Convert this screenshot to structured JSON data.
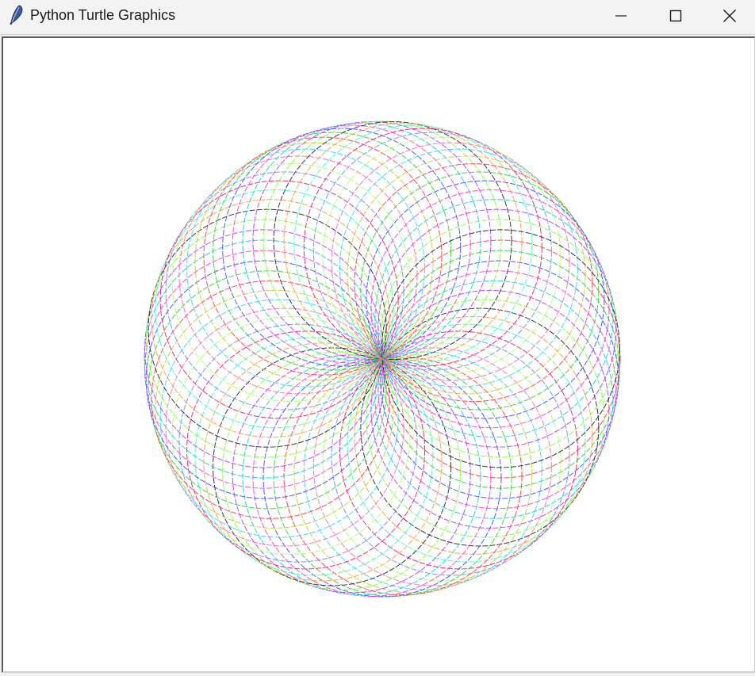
{
  "window": {
    "title": "Python Turtle Graphics",
    "app_icon": "feather-icon",
    "controls": {
      "minimize": "minimize-icon",
      "maximize": "maximize-icon",
      "close": "close-icon"
    }
  },
  "canvas": {
    "background": "#ffffff",
    "drawing": "spirograph",
    "circle_count": 72,
    "colors": [
      "#ff3b3b",
      "#2fd13a",
      "#3a4bff",
      "#ff3bd6",
      "#19c7e6",
      "#b23bff",
      "#7aff3b",
      "#222222",
      "#ff9a3b",
      "#3bffb5",
      "#e61979",
      "#6f8cff",
      "#a8ff6a",
      "#ff6ab0",
      "#3bd1ff",
      "#c8c83b"
    ]
  }
}
